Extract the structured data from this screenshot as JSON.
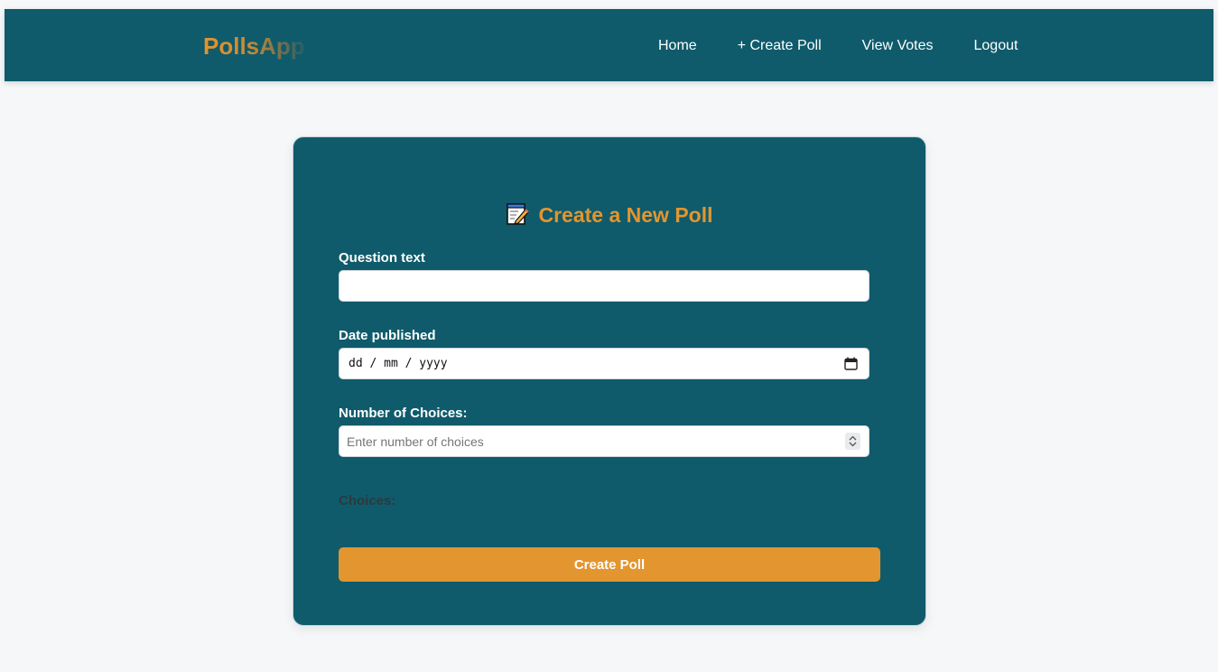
{
  "brand": {
    "name": "PollsApp",
    "color": "#e3952f"
  },
  "nav": {
    "home": "Home",
    "create_poll": "+ Create Poll",
    "view_votes": "View Votes",
    "logout": "Logout"
  },
  "form": {
    "title": "Create a New Poll",
    "title_icon": "memo-icon",
    "question": {
      "label": "Question text",
      "value": ""
    },
    "date": {
      "label": "Date published",
      "value": "dd / mm / yyyy",
      "icon": "calendar-icon"
    },
    "num_choices": {
      "label": "Number of Choices:",
      "placeholder": "Enter number of choices",
      "icon": "spinner-icon"
    },
    "choices_label": "Choices:",
    "submit_label": "Create Poll"
  },
  "colors": {
    "primary": "#0f5b6b",
    "accent": "#e3952f",
    "background": "#f5f7f9"
  }
}
